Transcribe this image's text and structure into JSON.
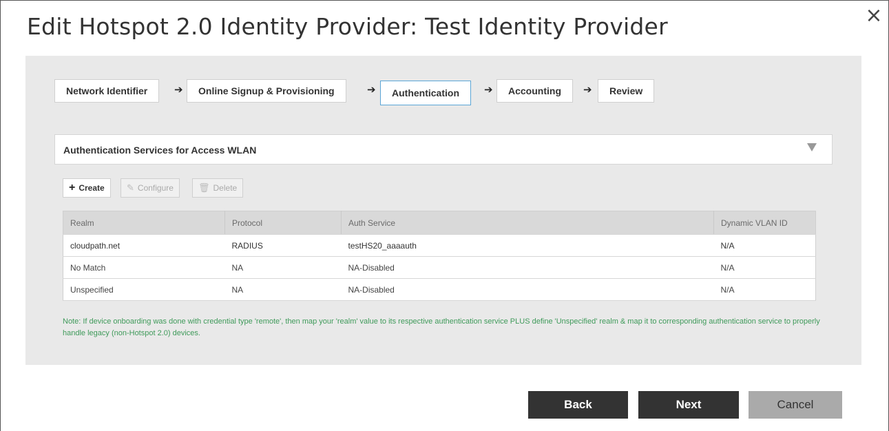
{
  "dialog": {
    "title": "Edit Hotspot 2.0 Identity Provider: Test Identity Provider",
    "close_glyph": "×"
  },
  "steps": [
    {
      "label": "Network Identifier",
      "active": false
    },
    {
      "label": "Online Signup & Provisioning",
      "active": false
    },
    {
      "label": "Authentication",
      "active": true
    },
    {
      "label": "Accounting",
      "active": false
    },
    {
      "label": "Review",
      "active": false
    }
  ],
  "arrow_glyph": "➔",
  "section": {
    "title": "Authentication Services for Access WLAN"
  },
  "toolbar": {
    "create_label": "Create",
    "configure_label": "Configure",
    "delete_label": "Delete"
  },
  "table": {
    "headers": [
      "Realm",
      "Protocol",
      "Auth Service",
      "Dynamic VLAN ID"
    ],
    "rows": [
      [
        "cloudpath.net",
        "RADIUS",
        "testHS20_aaaauth",
        "N/A"
      ],
      [
        "No Match",
        "NA",
        "NA-Disabled",
        "N/A"
      ],
      [
        "Unspecified",
        "NA",
        "NA-Disabled",
        "N/A"
      ]
    ]
  },
  "note": "Note: If device onboarding was done with credential type 'remote', then map your 'realm' value to its respective authentication service PLUS define 'Unspecified' realm & map it to corresponding authentication service to properly handle legacy (non-Hotspot 2.0) devices.",
  "footer": {
    "back_label": "Back",
    "next_label": "Next",
    "cancel_label": "Cancel"
  },
  "colors": {
    "primary_button": "#333333",
    "cancel_button": "#aaaaaa",
    "active_step_border": "#5aa5d6",
    "note_text": "#3f9a5a",
    "panel_bg": "#e9e9e9"
  },
  "icons": {
    "create": "plus-icon",
    "configure": "pencil-icon",
    "delete": "trash-icon",
    "section_toggle": "triangle-down-icon",
    "close": "close-icon"
  }
}
